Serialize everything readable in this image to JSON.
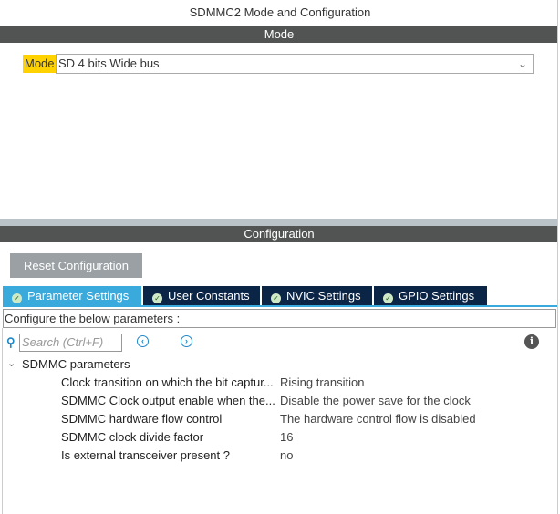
{
  "title": "SDMMC2 Mode and Configuration",
  "mode_section": {
    "header": "Mode",
    "mode_label": "Mode",
    "mode_value": "SD 4 bits Wide bus"
  },
  "config_section": {
    "header": "Configuration",
    "reset_label": "Reset Configuration",
    "tabs": [
      {
        "label": "Parameter Settings",
        "active": true
      },
      {
        "label": "User Constants"
      },
      {
        "label": "NVIC Settings"
      },
      {
        "label": "GPIO Settings"
      }
    ],
    "configure_text": "Configure the below parameters :",
    "search_placeholder": "Search (Ctrl+F)",
    "group": "SDMMC parameters",
    "params": [
      {
        "name": "Clock transition on which the bit captur...",
        "value": "Rising transition"
      },
      {
        "name": "SDMMC Clock output enable when the...",
        "value": "Disable the power save for the clock"
      },
      {
        "name": "SDMMC hardware flow control",
        "value": "The hardware control flow is disabled"
      },
      {
        "name": "SDMMC clock divide factor",
        "value": "16"
      },
      {
        "name": "Is external transceiver present ?",
        "value": "no"
      }
    ]
  }
}
